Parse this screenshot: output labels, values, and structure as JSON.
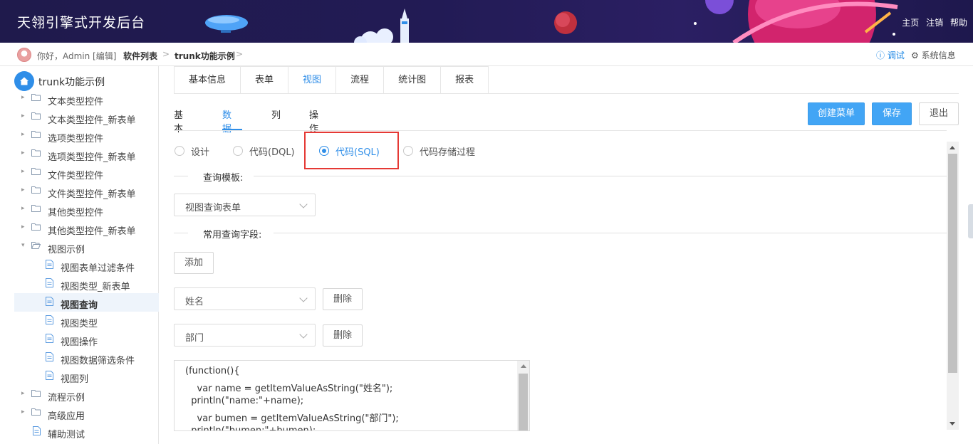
{
  "header": {
    "app_title": "天翎引擎式开发后台",
    "links": [
      "主页",
      "注销",
      "帮助"
    ]
  },
  "breadcrumb": {
    "greeting": "你好，Admin [编辑]",
    "items": [
      "软件列表",
      "trunk功能示例"
    ],
    "separator": ">",
    "debug_label": "ⓘ 调试",
    "sysinfo_label": "⚙ 系统信息"
  },
  "sidebar": {
    "root_label": "trunk功能示例",
    "items": [
      {
        "label": "文本类型控件"
      },
      {
        "label": "文本类型控件_新表单"
      },
      {
        "label": "选项类型控件"
      },
      {
        "label": "选项类型控件_新表单"
      },
      {
        "label": "文件类型控件"
      },
      {
        "label": "文件类型控件_新表单"
      },
      {
        "label": "其他类型控件"
      },
      {
        "label": "其他类型控件_新表单"
      },
      {
        "label": "视图示例"
      },
      {
        "label": "视图表单过滤条件"
      },
      {
        "label": "视图类型_新表单"
      },
      {
        "label": "视图查询"
      },
      {
        "label": "视图类型"
      },
      {
        "label": "视图操作"
      },
      {
        "label": "视图数据筛选条件"
      },
      {
        "label": "视图列"
      },
      {
        "label": "流程示例"
      },
      {
        "label": "高级应用"
      },
      {
        "label": "辅助测试"
      }
    ],
    "active_item": "视图查询"
  },
  "main": {
    "tabs": [
      {
        "label": "基本信息"
      },
      {
        "label": "表单"
      },
      {
        "label": "视图"
      },
      {
        "label": "流程"
      },
      {
        "label": "统计图"
      },
      {
        "label": "报表"
      }
    ],
    "active_tab": "视图",
    "subtabs": [
      {
        "label": "基本"
      },
      {
        "label": "数据"
      },
      {
        "label": "列"
      },
      {
        "label": "操作"
      }
    ],
    "active_subtab": "数据",
    "buttons": {
      "create_menu": "创建菜单",
      "save": "保存",
      "exit": "退出"
    },
    "radios": [
      {
        "label": "设计"
      },
      {
        "label": "代码(DQL)"
      },
      {
        "label": "代码(SQL)"
      },
      {
        "label": "代码存储过程"
      }
    ],
    "selected_radio": "代码(SQL)",
    "query_template": {
      "title": "查询模板:",
      "selected": "视图查询表单"
    },
    "common_fields": {
      "title": "常用查询字段:",
      "add_label": "添加",
      "fields": [
        {
          "value": "姓名",
          "delete_label": "删除"
        },
        {
          "value": "部门",
          "delete_label": "删除"
        }
      ]
    },
    "code_lines": [
      "(function(){",
      "    var name = getItemValueAsString(\"姓名\");",
      "  println(\"name:\"+name);",
      "    var bumen = getItemValueAsString(\"部门\");",
      "  println(\"bumen:\"+bumen);"
    ]
  },
  "colors": {
    "accent": "#2f8ee8",
    "primary_button": "#42a5f5",
    "highlight": "#e53935",
    "banner": "#221b55"
  }
}
